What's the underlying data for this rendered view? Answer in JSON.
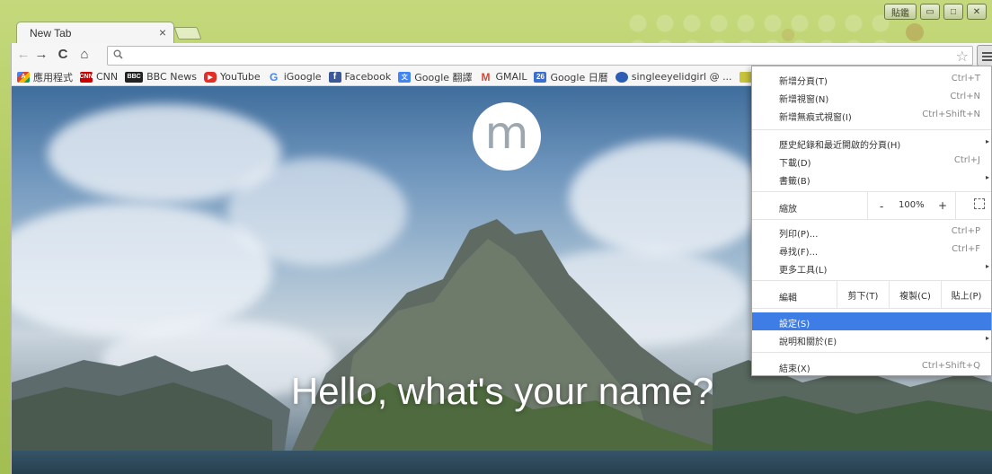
{
  "window": {
    "user_button": "貼鑑",
    "minimize_glyph": "▭",
    "maximize_glyph": "□",
    "close_glyph": "✕"
  },
  "tab": {
    "title": "New Tab",
    "close_glyph": "×"
  },
  "toolbar": {
    "back_glyph": "←",
    "forward_glyph": "→",
    "reload_glyph": "C",
    "home_glyph": "⌂",
    "omnibox_icon": "magnifier-icon",
    "omnibox_value": "",
    "star_glyph": "☆"
  },
  "bookmarks": [
    {
      "label": "應用程式",
      "icon": "A",
      "cls": "apps"
    },
    {
      "label": "CNN",
      "icon": "CNN",
      "cls": "cnn"
    },
    {
      "label": "BBC News",
      "icon": "BBC",
      "cls": "bbc"
    },
    {
      "label": "YouTube",
      "icon": "▶",
      "cls": "yt"
    },
    {
      "label": "iGoogle",
      "icon": "G",
      "cls": "g"
    },
    {
      "label": "Facebook",
      "icon": "f",
      "cls": "fb"
    },
    {
      "label": "Google 翻譯",
      "icon": "文",
      "cls": "gt"
    },
    {
      "label": "GMAIL",
      "icon": "M",
      "cls": "gm"
    },
    {
      "label": "Google 日曆",
      "icon": "26",
      "cls": "cal"
    },
    {
      "label": "singleeyelidgirl @ ...",
      "icon": "",
      "cls": "blog"
    },
    {
      "label": "",
      "icon": "",
      "cls": "more"
    }
  ],
  "newtab": {
    "logo_letter": "m",
    "greeting": "Hello, what's your name?"
  },
  "menu": {
    "new_tab": {
      "label": "新增分頁(T)",
      "shortcut": "Ctrl+T"
    },
    "new_window": {
      "label": "新增視窗(N)",
      "shortcut": "Ctrl+N"
    },
    "incognito": {
      "label": "新增無痕式視窗(I)",
      "shortcut": "Ctrl+Shift+N"
    },
    "history": {
      "label": "歷史紀錄和最近開啟的分頁(H)"
    },
    "downloads": {
      "label": "下載(D)",
      "shortcut": "Ctrl+J"
    },
    "bookmarks": {
      "label": "書籤(B)"
    },
    "zoom": {
      "label": "縮放",
      "minus": "-",
      "value": "100%",
      "plus": "+"
    },
    "print": {
      "label": "列印(P)...",
      "shortcut": "Ctrl+P"
    },
    "find": {
      "label": "尋找(F)...",
      "shortcut": "Ctrl+F"
    },
    "more_tools": {
      "label": "更多工具(L)"
    },
    "edit": {
      "label": "編輯",
      "cut": "剪下(T)",
      "copy": "複製(C)",
      "paste": "貼上(P)"
    },
    "settings": {
      "label": "設定(S)"
    },
    "help": {
      "label": "說明和關於(E)"
    },
    "exit": {
      "label": "結束(X)",
      "shortcut": "Ctrl+Shift+Q"
    },
    "submenu_glyph": "▸"
  }
}
